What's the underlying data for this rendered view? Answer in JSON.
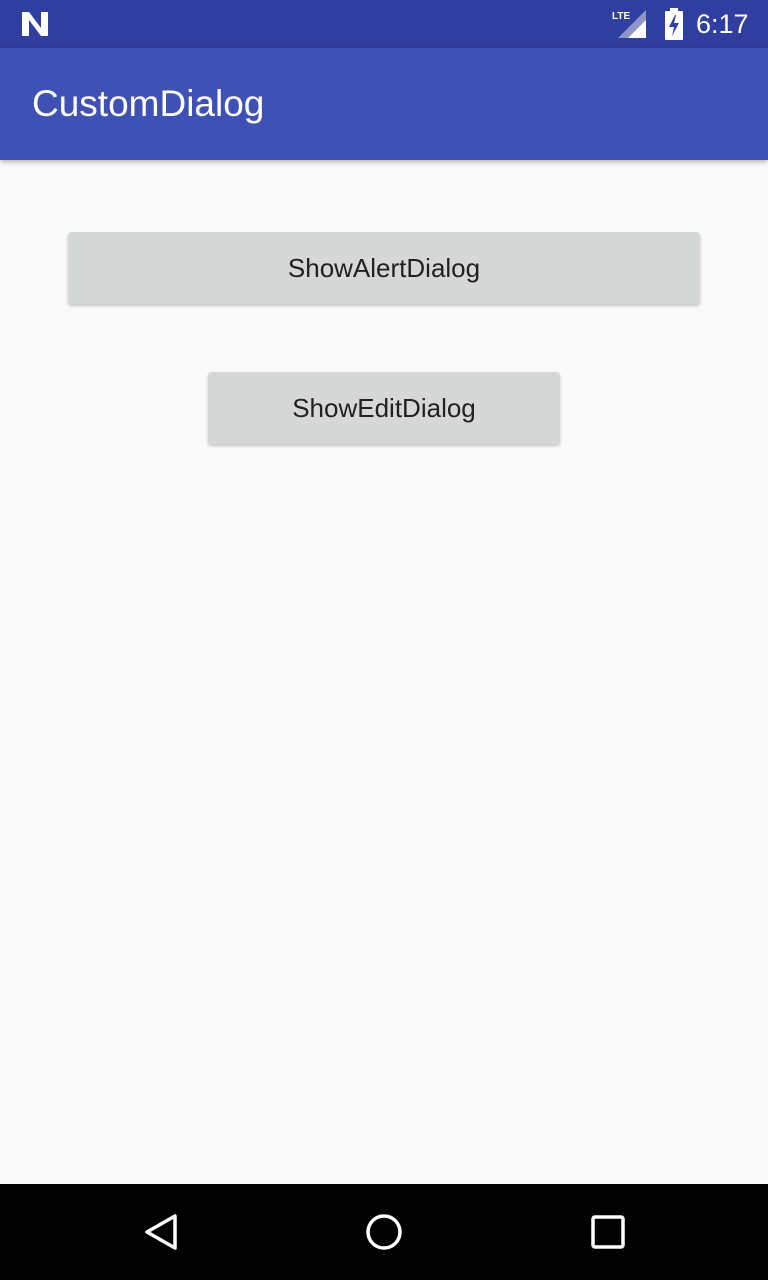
{
  "status_bar": {
    "time": "6:17",
    "network_label": "LTE",
    "icons": [
      "notification-n-icon",
      "lte-signal-icon",
      "battery-charging-icon"
    ],
    "background": "#303f9f"
  },
  "app_bar": {
    "title": "CustomDialog",
    "background": "#3f51b5"
  },
  "buttons": {
    "show_alert_label": "ShowAlertDialog",
    "show_edit_label": "ShowEditDialog"
  },
  "nav_bar": {
    "icons": [
      "back-icon",
      "home-icon",
      "recent-apps-icon"
    ]
  }
}
